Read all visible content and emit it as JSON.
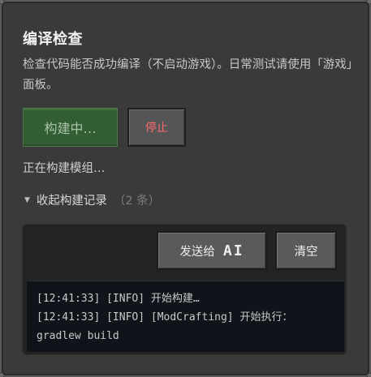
{
  "panel": {
    "title": "编译检查",
    "description": "检查代码能否成功编译（不启动游戏）。日常测试请使用「游戏」面板。"
  },
  "build": {
    "building_label": "构建中…",
    "stop_label": "停止",
    "status_text": "正在构建模组…"
  },
  "log": {
    "toggle_label": "收起构建记录",
    "count_label": "（2 条）",
    "send_label": "发送给",
    "send_ai_label": "AI",
    "clear_label": "清空",
    "lines": [
      "[12:41:33] [INFO] 开始构建…",
      "[12:41:33] [INFO] [ModCrafting] 开始执行：",
      "gradlew build"
    ]
  },
  "colors": {
    "panel_bg": "#3a3a3a",
    "building_button_bg": "#335d33",
    "stop_text": "#ff6b6b",
    "log_bg": "#10131a"
  }
}
